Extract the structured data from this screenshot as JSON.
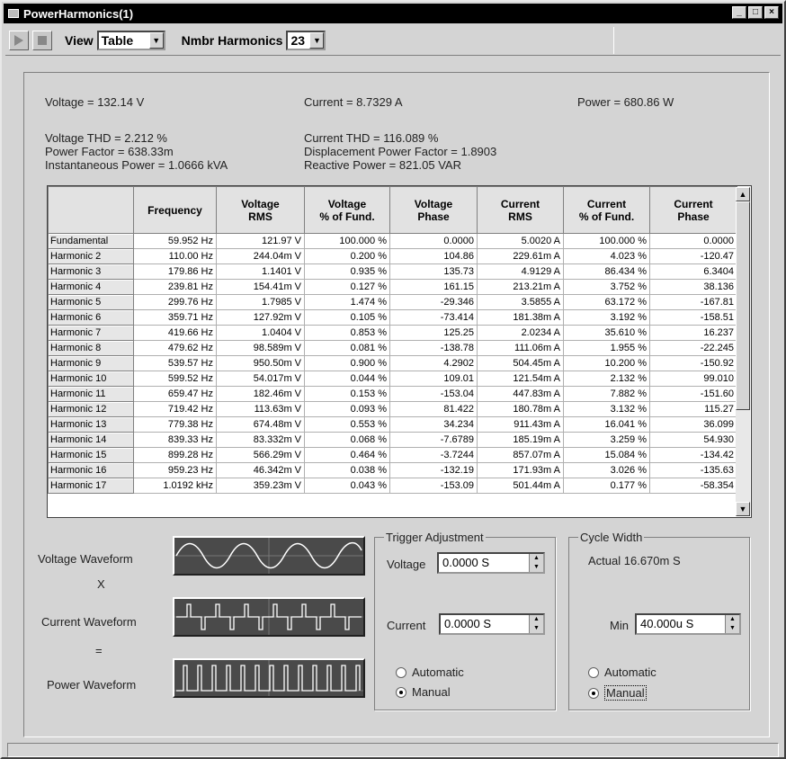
{
  "window": {
    "title": "PowerHarmonics(1)",
    "buttons": {
      "minimize": "_",
      "maximize": "□",
      "close": "×"
    }
  },
  "toolbar": {
    "view_label": "View",
    "view_value": "Table",
    "harmonics_label": "Nmbr Harmonics",
    "harmonics_value": "23"
  },
  "summary": {
    "voltage": "Voltage = 132.14 V",
    "current": "Current = 8.7329 A",
    "power": "Power = 680.86 W",
    "voltage_thd": "Voltage THD =  2.212 %",
    "power_factor": "Power Factor =  638.33m",
    "instantaneous_power": "Instantaneous Power = 1.0666 kVA",
    "current_thd": "Current THD = 116.089 %",
    "displacement_pf": "Displacement Power Factor =  1.8903",
    "reactive_power": "Reactive Power =  821.05 VAR"
  },
  "table": {
    "columns": [
      "",
      "Frequency",
      "Voltage\nRMS",
      "Voltage\n% of Fund.",
      "Voltage\nPhase",
      "Current\nRMS",
      "Current\n% of Fund.",
      "Current\nPhase"
    ],
    "rows": [
      [
        "Fundamental",
        "59.952 Hz",
        "121.97 V",
        "100.000 %",
        "0.0000",
        "5.0020 A",
        "100.000 %",
        "0.0000"
      ],
      [
        "Harmonic 2",
        "110.00 Hz",
        "244.04m V",
        "0.200 %",
        "104.86",
        "229.61m A",
        "4.023 %",
        "-120.47"
      ],
      [
        "Harmonic 3",
        "179.86 Hz",
        "1.1401 V",
        "0.935 %",
        "135.73",
        "4.9129 A",
        "86.434 %",
        "6.3404"
      ],
      [
        "Harmonic 4",
        "239.81 Hz",
        "154.41m V",
        "0.127 %",
        "161.15",
        "213.21m A",
        "3.752 %",
        "38.136"
      ],
      [
        "Harmonic 5",
        "299.76 Hz",
        "1.7985 V",
        "1.474 %",
        "-29.346",
        "3.5855 A",
        "63.172 %",
        "-167.81"
      ],
      [
        "Harmonic 6",
        "359.71 Hz",
        "127.92m V",
        "0.105 %",
        "-73.414",
        "181.38m A",
        "3.192 %",
        "-158.51"
      ],
      [
        "Harmonic 7",
        "419.66 Hz",
        "1.0404 V",
        "0.853 %",
        "125.25",
        "2.0234 A",
        "35.610 %",
        "16.237"
      ],
      [
        "Harmonic 8",
        "479.62 Hz",
        "98.589m V",
        "0.081 %",
        "-138.78",
        "111.06m A",
        "1.955 %",
        "-22.245"
      ],
      [
        "Harmonic 9",
        "539.57 Hz",
        "950.50m V",
        "0.900 %",
        "4.2902",
        "504.45m A",
        "10.200 %",
        "-150.92"
      ],
      [
        "Harmonic 10",
        "599.52 Hz",
        "54.017m V",
        "0.044 %",
        "109.01",
        "121.54m A",
        "2.132 %",
        "99.010"
      ],
      [
        "Harmonic 11",
        "659.47 Hz",
        "182.46m V",
        "0.153 %",
        "-153.04",
        "447.83m A",
        "7.882 %",
        "-151.60"
      ],
      [
        "Harmonic 12",
        "719.42 Hz",
        "113.63m V",
        "0.093 %",
        "81.422",
        "180.78m A",
        "3.132 %",
        "115.27"
      ],
      [
        "Harmonic 13",
        "779.38 Hz",
        "674.48m V",
        "0.553 %",
        "34.234",
        "911.43m A",
        "16.041 %",
        "36.099"
      ],
      [
        "Harmonic 14",
        "839.33 Hz",
        "83.332m V",
        "0.068 %",
        "-7.6789",
        "185.19m A",
        "3.259 %",
        "54.930"
      ],
      [
        "Harmonic 15",
        "899.28 Hz",
        "566.29m V",
        "0.464 %",
        "-3.7244",
        "857.07m A",
        "15.084 %",
        "-134.42"
      ],
      [
        "Harmonic 16",
        "959.23 Hz",
        "46.342m V",
        "0.038 %",
        "-132.19",
        "171.93m A",
        "3.026 %",
        "-135.63"
      ],
      [
        "Harmonic 17",
        "1.0192 kHz",
        "359.23m V",
        "0.043 %",
        "-153.09",
        "501.44m A",
        "0.177 %",
        "-58.354"
      ]
    ]
  },
  "waveforms": {
    "voltage_label": "Voltage Waveform",
    "times": "X",
    "current_label": "Current Waveform",
    "equals": "=",
    "power_label": "Power Waveform"
  },
  "trigger": {
    "legend": "Trigger Adjustment",
    "voltage_label": "Voltage",
    "voltage_value": "0.0000 S",
    "current_label": "Current",
    "current_value": "0.0000 S",
    "automatic": "Automatic",
    "manual": "Manual"
  },
  "cycle": {
    "legend": "Cycle Width",
    "actual": "Actual  16.670m S",
    "min_label": "Min",
    "min_value": "40.000u S",
    "automatic": "Automatic",
    "manual": "Manual"
  }
}
